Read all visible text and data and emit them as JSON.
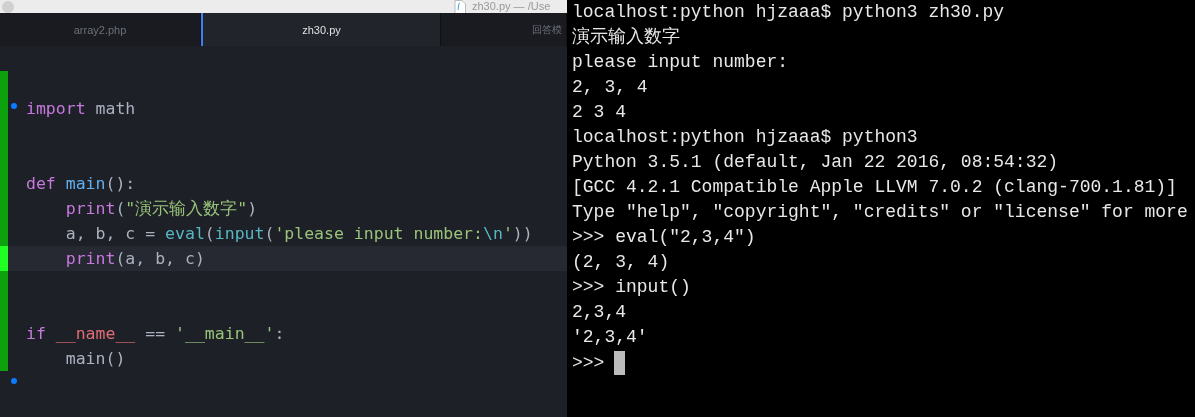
{
  "window": {
    "title": "zh30.py — /Use"
  },
  "tabs": [
    {
      "label": "array2.php",
      "selected": false
    },
    {
      "label": "zh30.py",
      "selected": true
    },
    {
      "label": "回答模",
      "selected": false
    }
  ],
  "editor": {
    "lines": [
      {
        "changed": true,
        "current": false,
        "marker": false
      },
      {
        "changed": true,
        "tokens": [
          {
            "kind": "keyword",
            "text": "import"
          },
          {
            "kind": "plain",
            "text": " math"
          }
        ],
        "current": false,
        "marker": true
      },
      {
        "changed": true,
        "current": false,
        "marker": false
      },
      {
        "changed": true,
        "current": false,
        "marker": false
      },
      {
        "changed": true,
        "tokens": [
          {
            "kind": "keyword",
            "text": "def"
          },
          {
            "kind": "func",
            "text": " main"
          },
          {
            "kind": "plain",
            "text": "():"
          }
        ],
        "current": false,
        "marker": false
      },
      {
        "changed": true,
        "tokens": [
          {
            "kind": "keyword",
            "text": "    print"
          },
          {
            "kind": "plain",
            "text": "("
          },
          {
            "kind": "string",
            "text": "\"演示输入数字\""
          },
          {
            "kind": "plain",
            "text": ")"
          }
        ],
        "current": false,
        "marker": false
      },
      {
        "changed": true,
        "tokens": [
          {
            "kind": "plain",
            "text": "    a, b, c = "
          },
          {
            "kind": "builtin",
            "text": "eval"
          },
          {
            "kind": "plain",
            "text": "("
          },
          {
            "kind": "builtin",
            "text": "input"
          },
          {
            "kind": "plain",
            "text": "("
          },
          {
            "kind": "string",
            "text": "'please input number:"
          },
          {
            "kind": "builtin",
            "text": "\\n"
          },
          {
            "kind": "string",
            "text": "'"
          },
          {
            "kind": "plain",
            "text": "))"
          }
        ],
        "current": false,
        "marker": false
      },
      {
        "changed": true,
        "tokens": [
          {
            "kind": "keyword",
            "text": "    print"
          },
          {
            "kind": "plain",
            "text": "(a, b, c)"
          }
        ],
        "current": true,
        "marker": false
      },
      {
        "changed": true,
        "current": false,
        "marker": false
      },
      {
        "changed": true,
        "current": false,
        "marker": false
      },
      {
        "changed": true,
        "tokens": [
          {
            "kind": "keyword",
            "text": "if"
          },
          {
            "kind": "dunder",
            "text": " __name__"
          },
          {
            "kind": "plain",
            "text": " == "
          },
          {
            "kind": "string",
            "text": "'__main__'"
          },
          {
            "kind": "plain",
            "text": ":"
          }
        ],
        "current": false,
        "marker": false
      },
      {
        "changed": true,
        "tokens": [
          {
            "kind": "plain",
            "text": "    main()"
          }
        ],
        "current": false,
        "marker": false
      },
      {
        "changed": false,
        "current": false,
        "marker": true
      }
    ]
  },
  "terminal": {
    "lines": [
      "localhost:python hjzaaa$ python3 zh30.py",
      "演示输入数字",
      "please input number:",
      "2, 3, 4",
      "2 3 4",
      "localhost:python hjzaaa$ python3",
      "Python 3.5.1 (default, Jan 22 2016, 08:54:32)",
      "[GCC 4.2.1 Compatible Apple LLVM 7.0.2 (clang-700.1.81)]",
      "Type \"help\", \"copyright\", \"credits\" or \"license\" for more",
      ">>> eval(\"2,3,4\")",
      "(2, 3, 4)",
      ">>> input()",
      "2,3,4",
      "'2,3,4'"
    ],
    "prompt": ">>>"
  }
}
